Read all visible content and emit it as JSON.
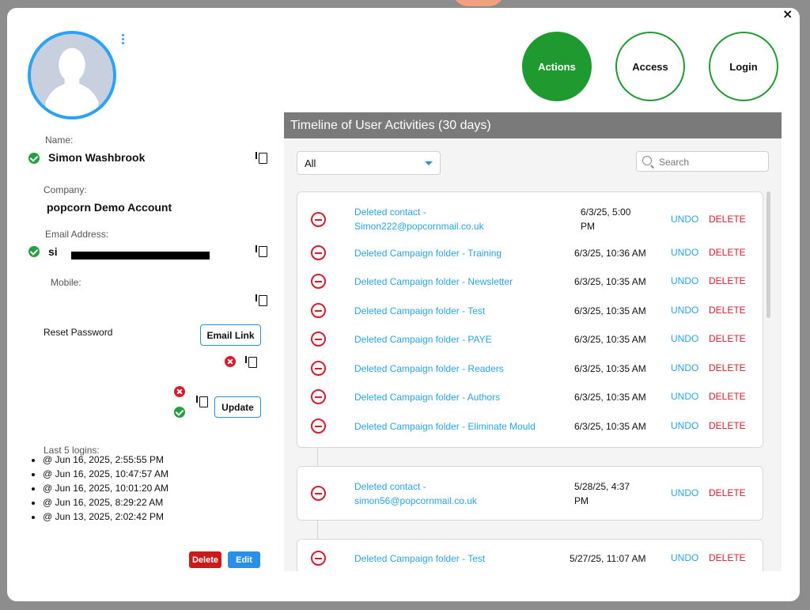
{
  "profile": {
    "name_label": "Name:",
    "name": "Simon Washbrook",
    "company_label": "Company:",
    "company": "popcorn Demo Account",
    "email_label": "Email Address:",
    "email_visible": "si",
    "mobile_label": "Mobile:",
    "reset_label": "Reset Password",
    "email_link_btn": "Email Link",
    "update_btn": "Update",
    "logins_title": "Last 5 logins:",
    "logins": [
      "@ Jun 16, 2025, 2:55:55 PM",
      "@ Jun 16, 2025, 10:47:57 AM",
      "@ Jun 16, 2025, 10:01:20 AM",
      "@ Jun 16, 2025, 8:29:22 AM",
      "@ Jun 13, 2025, 2:02:42 PM"
    ],
    "delete_btn": "Delete",
    "edit_btn": "Edit"
  },
  "actions": {
    "actions": "Actions",
    "access": "Access",
    "login": "Login"
  },
  "close_symbol": "×",
  "timeline": {
    "title": "Timeline of User Activities (30 days)",
    "filter_value": "All",
    "search_placeholder": "Search",
    "undo": "UNDO",
    "delete": "DELETE",
    "group1": [
      {
        "desc1": "Deleted contact -",
        "desc2": "Simon222@popcornmail.co.uk",
        "when1": "6/3/25, 5:00",
        "when2": "PM"
      },
      {
        "desc": "Deleted Campaign folder - Training",
        "when": "6/3/25, 10:36 AM"
      },
      {
        "desc": "Deleted Campaign folder - Newsletter",
        "when": "6/3/25, 10:35 AM"
      },
      {
        "desc": "Deleted Campaign folder - Test",
        "when": "6/3/25, 10:35 AM"
      },
      {
        "desc": "Deleted Campaign folder - PAYE",
        "when": "6/3/25, 10:35 AM"
      },
      {
        "desc": "Deleted Campaign folder - Readers",
        "when": "6/3/25, 10:35 AM"
      },
      {
        "desc": "Deleted Campaign folder - Authors",
        "when": "6/3/25, 10:35 AM"
      },
      {
        "desc": "Deleted Campaign folder - Eliminate Mould",
        "when": "6/3/25, 10:35 AM"
      }
    ],
    "group2": [
      {
        "desc1": "Deleted contact -",
        "desc2": "simon56@popcornmail.co.uk",
        "when1": "5/28/25, 4:37",
        "when2": "PM"
      }
    ],
    "group3": [
      {
        "desc": "Deleted Campaign folder - Test",
        "when": "5/27/25, 11:07 AM"
      }
    ]
  }
}
